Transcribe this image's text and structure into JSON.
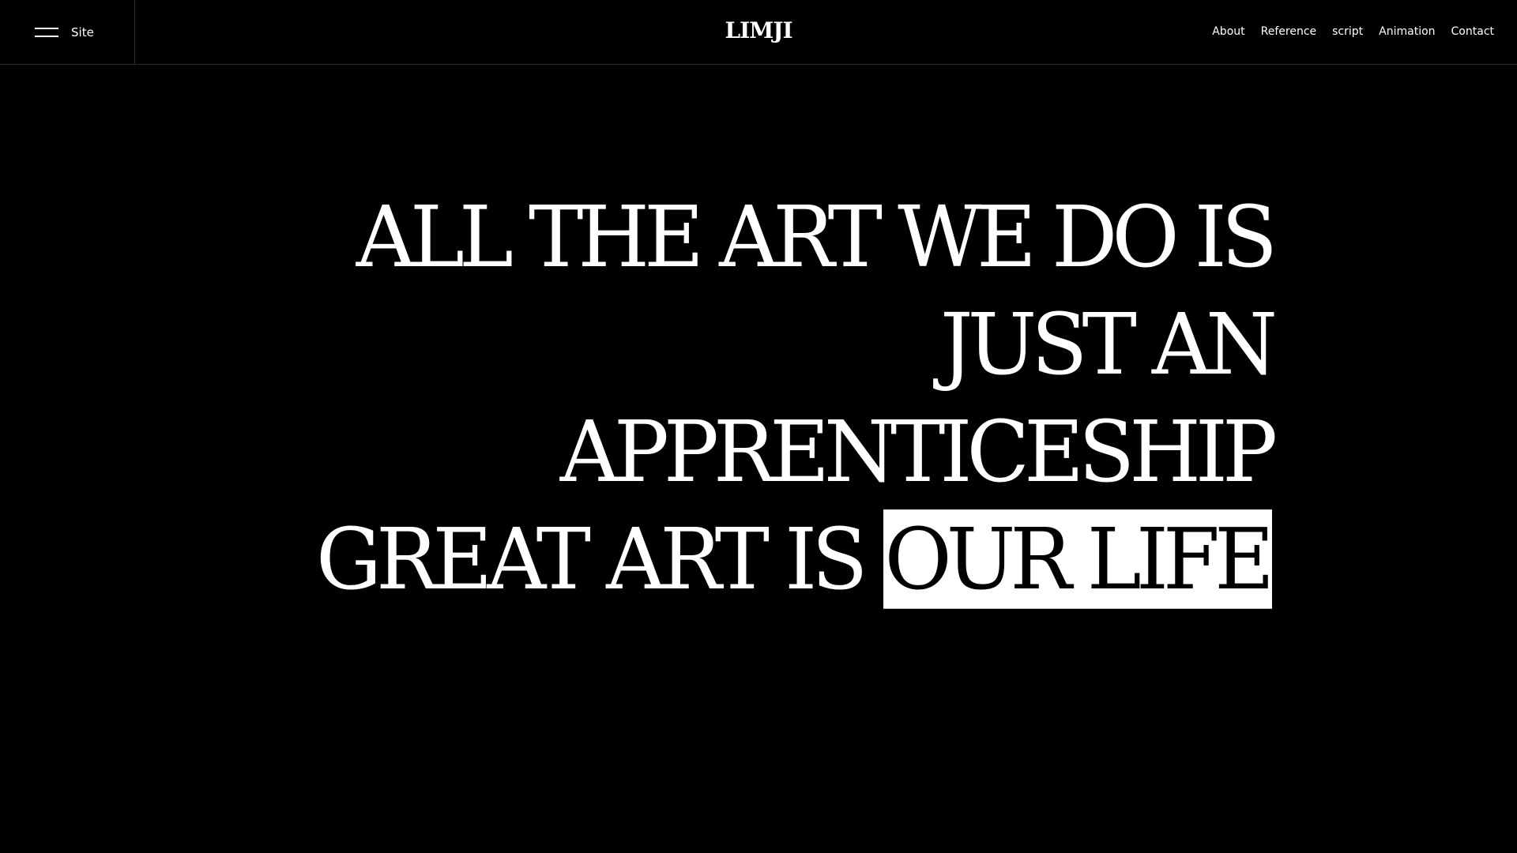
{
  "header": {
    "menu_label": "Site",
    "logo": "LIMJI",
    "nav": [
      "About",
      "Reference",
      "script",
      "Animation",
      "Contact"
    ]
  },
  "hero": {
    "line1": "ALL THE ART WE DO IS",
    "line2": "JUST AN",
    "line3": "APPRENTICESHIP",
    "line4_plain": "GREAT ART IS",
    "line4_highlight": "OUR LIFE"
  },
  "colors": {
    "background": "#000000",
    "text": "#ffffff",
    "highlight_bg": "#ffffff",
    "highlight_text": "#000000"
  },
  "icons": {
    "menu": "hamburger-icon"
  }
}
